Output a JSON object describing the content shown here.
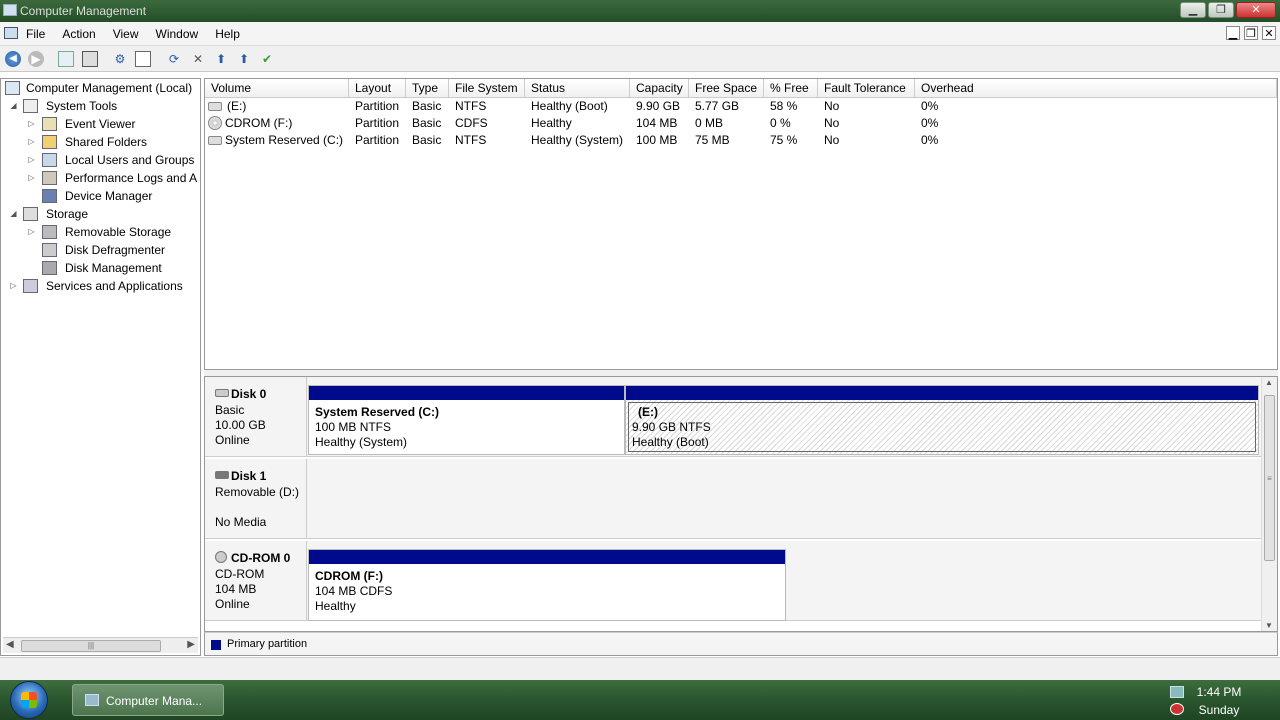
{
  "window": {
    "title": "Computer Management"
  },
  "menu": {
    "items": [
      "File",
      "Action",
      "View",
      "Window",
      "Help"
    ]
  },
  "mdi": {
    "min": "▁",
    "restore": "❐",
    "close": "✕"
  },
  "winbtns": {
    "min": "▁",
    "restore": "❐",
    "close": "✕"
  },
  "tree": {
    "items": [
      {
        "label": "Computer Management (Local)",
        "expander": "",
        "icon": "computer-management-icon"
      },
      {
        "label": "System Tools",
        "expander": "◢",
        "icon": "system-tools-icon"
      },
      {
        "label": "Event Viewer",
        "expander": "▷",
        "icon": "event-viewer-icon"
      },
      {
        "label": "Shared Folders",
        "expander": "▷",
        "icon": "shared-folders-icon"
      },
      {
        "label": "Local Users and Groups",
        "expander": "▷",
        "icon": "local-users-icon"
      },
      {
        "label": "Performance Logs and A",
        "expander": "▷",
        "icon": "performance-logs-icon"
      },
      {
        "label": "Device Manager",
        "expander": "",
        "icon": "device-manager-icon"
      },
      {
        "label": "Storage",
        "expander": "◢",
        "icon": "storage-icon"
      },
      {
        "label": "Removable Storage",
        "expander": "▷",
        "icon": "removable-storage-icon"
      },
      {
        "label": "Disk Defragmenter",
        "expander": "",
        "icon": "disk-defragmenter-icon"
      },
      {
        "label": "Disk Management",
        "expander": "",
        "icon": "disk-management-icon"
      },
      {
        "label": "Services and Applications",
        "expander": "▷",
        "icon": "services-applications-icon"
      }
    ]
  },
  "volumes": {
    "columns": [
      "Volume",
      "Layout",
      "Type",
      "File System",
      "Status",
      "Capacity",
      "Free Space",
      "% Free",
      "Fault Tolerance",
      "Overhead"
    ],
    "rows": [
      [
        "(E:)",
        "Partition",
        "Basic",
        "NTFS",
        "Healthy (Boot)",
        "9.90 GB",
        "5.77 GB",
        "58 %",
        "No",
        "0%"
      ],
      [
        "CDROM (F:)",
        "Partition",
        "Basic",
        "CDFS",
        "Healthy",
        "104 MB",
        "0 MB",
        "0 %",
        "No",
        "0%"
      ],
      [
        "System Reserved (C:)",
        "Partition",
        "Basic",
        "NTFS",
        "Healthy (System)",
        "100 MB",
        "75 MB",
        "75 %",
        "No",
        "0%"
      ]
    ]
  },
  "disks": {
    "disk0": {
      "name": "Disk 0",
      "type": "Basic",
      "size": "10.00 GB",
      "status": "Online",
      "p1": {
        "name": "System Reserved  (C:)",
        "size": "100 MB NTFS",
        "status": "Healthy (System)"
      },
      "p2": {
        "name": "(E:)",
        "size": "9.90 GB NTFS",
        "status": "Healthy (Boot)"
      }
    },
    "disk1": {
      "name": "Disk 1",
      "type": "Removable (D:)",
      "status": "No Media"
    },
    "cdrom0": {
      "name": "CD-ROM 0",
      "type": "CD-ROM",
      "size": "104 MB",
      "status": "Online",
      "p1": {
        "name": "CDROM  (F:)",
        "size": "104 MB CDFS",
        "status": "Healthy"
      }
    }
  },
  "legend": {
    "primary": "Primary partition"
  },
  "colors": {
    "primary_partition": "#000a8c",
    "taskbar": "#2a552d"
  },
  "taskbar": {
    "task_label": "Computer Mana...",
    "time": "1:44 PM",
    "day": "Sunday"
  }
}
